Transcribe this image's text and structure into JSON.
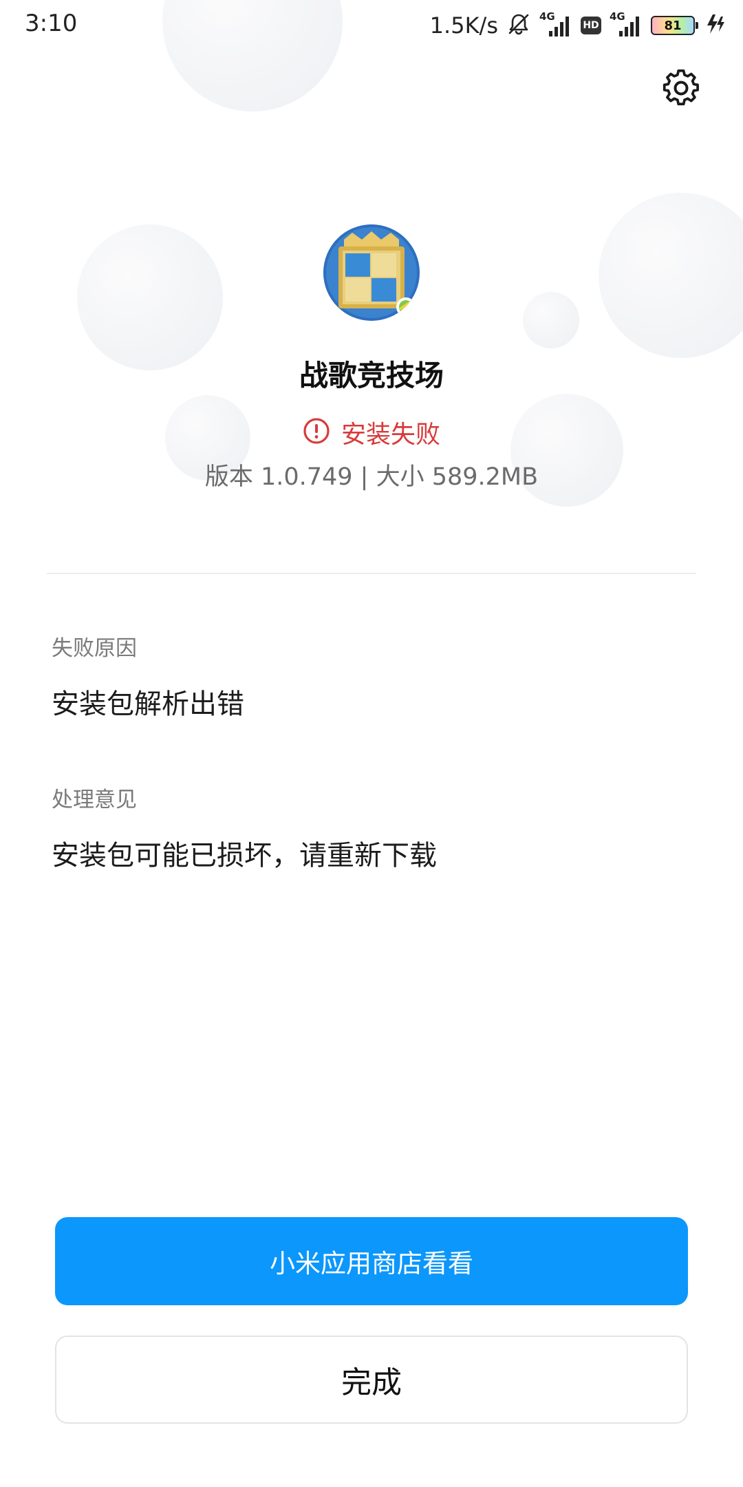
{
  "status_bar": {
    "time": "3:10",
    "net_speed": "1.5K/s",
    "signal_tag_1": "4G",
    "hd_label": "HD",
    "signal_tag_2": "4G",
    "battery_level": "81"
  },
  "app": {
    "name": "战歌竞技场",
    "status": "安装失败",
    "version_line": "版本 1.0.749 | 大小 589.2MB"
  },
  "details": {
    "reason_label": "失败原因",
    "reason_value": "安装包解析出错",
    "advice_label": "处理意见",
    "advice_value": "安装包可能已损坏，请重新下载"
  },
  "actions": {
    "store_button": "小米应用商店看看",
    "done_button": "完成"
  },
  "colors": {
    "accent": "#0c97fc",
    "error": "#d93a3a"
  },
  "icons": {
    "settings": "gear-icon",
    "status": "error-circle-icon",
    "mute": "bell-off-icon"
  }
}
